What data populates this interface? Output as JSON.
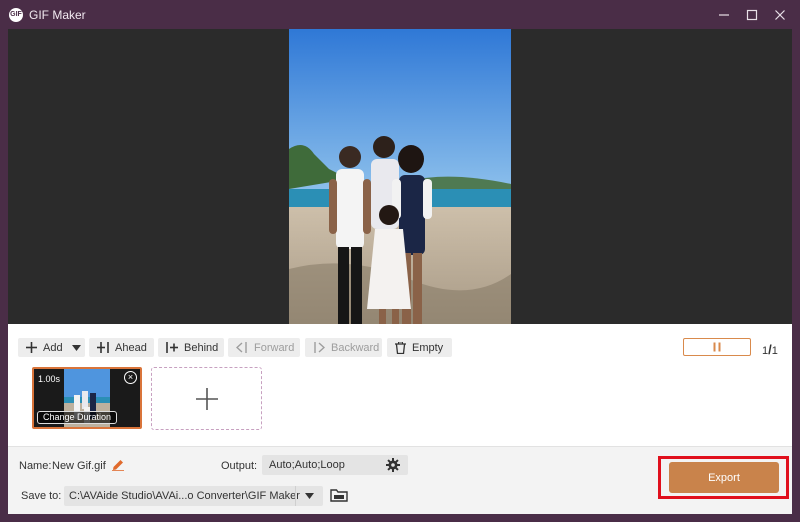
{
  "window": {
    "title": "GIF Maker",
    "app_icon_text": "GIF"
  },
  "toolbar": {
    "add_label": "Add",
    "ahead_label": "Ahead",
    "behind_label": "Behind",
    "forward_label": "Forward",
    "backward_label": "Backward",
    "empty_label": "Empty",
    "page_current": "1",
    "page_total": "1"
  },
  "frames": [
    {
      "duration": "1.00s",
      "change_label": "Change Duration"
    }
  ],
  "bottom": {
    "name_label": "Name:",
    "name_value": "New Gif.gif",
    "output_label": "Output:",
    "output_value": "Auto;Auto;Loop",
    "save_label": "Save to:",
    "save_value": "C:\\AVAide Studio\\AVAi...o Converter\\GIF Maker",
    "export_label": "Export"
  },
  "colors": {
    "titlebar": "#4a2d47",
    "accent": "#d98a4c",
    "export": "#c9834b",
    "highlight": "#e00f1c"
  },
  "icons": [
    "gif-maker-logo-icon",
    "minimize-icon",
    "maximize-icon",
    "close-icon",
    "plus-icon",
    "dropdown-arrow-icon",
    "pause-icon",
    "trash-icon",
    "edit-pencil-icon",
    "gear-icon",
    "folder-icon"
  ]
}
